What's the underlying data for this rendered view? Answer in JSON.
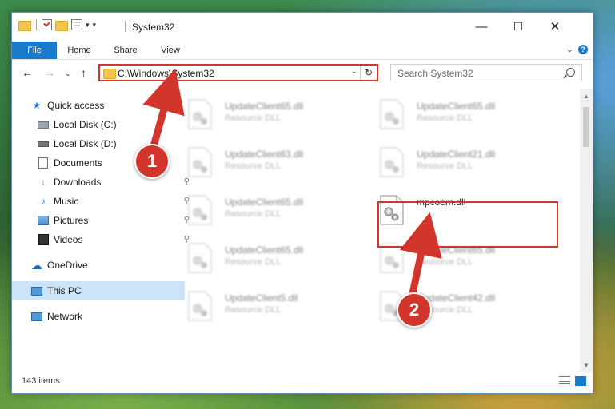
{
  "window": {
    "title": "System32",
    "controls": {
      "minimize": "—",
      "maximize": "☐",
      "close": "✕"
    }
  },
  "ribbon": {
    "tabs": [
      {
        "label": "File"
      },
      {
        "label": "Home"
      },
      {
        "label": "Share"
      },
      {
        "label": "View"
      }
    ]
  },
  "address": {
    "path": "C:\\Windows\\System32",
    "search_placeholder": "Search System32"
  },
  "sidebar": {
    "items": [
      {
        "label": "Quick access",
        "icon": "star-icon"
      },
      {
        "label": "Local Disk (C:)",
        "icon": "drive-icon"
      },
      {
        "label": "Local Disk (D:)",
        "icon": "drive-icon"
      },
      {
        "label": "Documents",
        "icon": "documents-icon"
      },
      {
        "label": "Downloads",
        "icon": "download-icon"
      },
      {
        "label": "Music",
        "icon": "music-icon"
      },
      {
        "label": "Pictures",
        "icon": "pictures-icon"
      },
      {
        "label": "Videos",
        "icon": "videos-icon"
      },
      {
        "label": "OneDrive",
        "icon": "cloud-icon"
      },
      {
        "label": "This PC",
        "icon": "computer-icon"
      },
      {
        "label": "Network",
        "icon": "network-icon"
      }
    ]
  },
  "files": [
    {
      "name": "UpdateClient65.dll",
      "desc": "Resource DLL"
    },
    {
      "name": "UpdateClient65.dll",
      "desc": "Resource DLL"
    },
    {
      "name": "UpdateClient63.dll",
      "desc": "Resource DLL"
    },
    {
      "name": "UpdateClient21.dll",
      "desc": "Resource DLL"
    },
    {
      "name": "UpdateClient65.dll",
      "desc": "Resource DLL"
    },
    {
      "name": "mpcoem.dll",
      "desc": ""
    },
    {
      "name": "UpdateClient65.dll",
      "desc": "Resource DLL"
    },
    {
      "name": "UpdateClient65.dll",
      "desc": "Resource DLL"
    },
    {
      "name": "UpdateClient5.dll",
      "desc": "Resource DLL"
    },
    {
      "name": "UpdateClient42.dll",
      "desc": "Resource DLL"
    }
  ],
  "status": {
    "count": "143 items"
  },
  "annotations": {
    "marker1": "1",
    "marker2": "2",
    "color": "#d2352b"
  }
}
